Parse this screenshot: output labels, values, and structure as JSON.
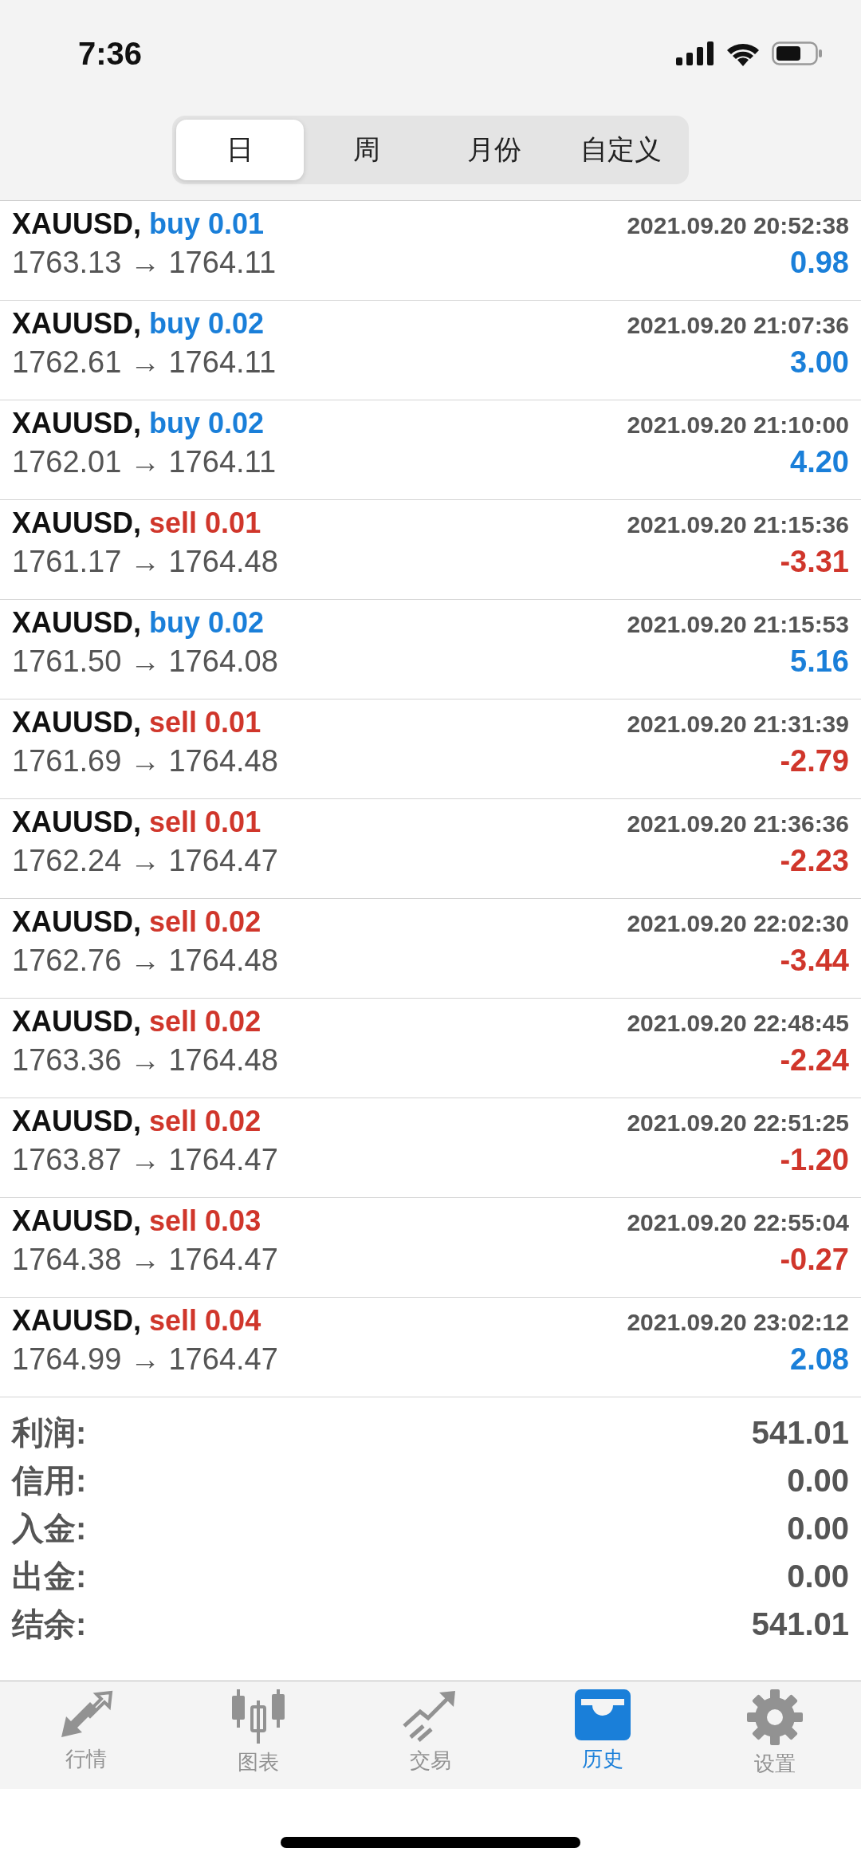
{
  "status_bar": {
    "time": "7:36"
  },
  "period_tabs": [
    {
      "label": "日",
      "selected": true
    },
    {
      "label": "周",
      "selected": false
    },
    {
      "label": "月份",
      "selected": false
    },
    {
      "label": "自定义",
      "selected": false
    }
  ],
  "deals": [
    {
      "symbol": "XAUUSD,",
      "kind": "buy",
      "order": "buy 0.01",
      "time": "2021.09.20 20:52:38",
      "prices": "1763.13 → 1764.11",
      "profit": "0.98",
      "profit_positive": true
    },
    {
      "symbol": "XAUUSD,",
      "kind": "buy",
      "order": "buy 0.02",
      "time": "2021.09.20 21:07:36",
      "prices": "1762.61 → 1764.11",
      "profit": "3.00",
      "profit_positive": true
    },
    {
      "symbol": "XAUUSD,",
      "kind": "buy",
      "order": "buy 0.02",
      "time": "2021.09.20 21:10:00",
      "prices": "1762.01 → 1764.11",
      "profit": "4.20",
      "profit_positive": true
    },
    {
      "symbol": "XAUUSD,",
      "kind": "sell",
      "order": "sell 0.01",
      "time": "2021.09.20 21:15:36",
      "prices": "1761.17 → 1764.48",
      "profit": "-3.31",
      "profit_positive": false
    },
    {
      "symbol": "XAUUSD,",
      "kind": "buy",
      "order": "buy 0.02",
      "time": "2021.09.20 21:15:53",
      "prices": "1761.50 → 1764.08",
      "profit": "5.16",
      "profit_positive": true
    },
    {
      "symbol": "XAUUSD,",
      "kind": "sell",
      "order": "sell 0.01",
      "time": "2021.09.20 21:31:39",
      "prices": "1761.69 → 1764.48",
      "profit": "-2.79",
      "profit_positive": false
    },
    {
      "symbol": "XAUUSD,",
      "kind": "sell",
      "order": "sell 0.01",
      "time": "2021.09.20 21:36:36",
      "prices": "1762.24 → 1764.47",
      "profit": "-2.23",
      "profit_positive": false
    },
    {
      "symbol": "XAUUSD,",
      "kind": "sell",
      "order": "sell 0.02",
      "time": "2021.09.20 22:02:30",
      "prices": "1762.76 → 1764.48",
      "profit": "-3.44",
      "profit_positive": false
    },
    {
      "symbol": "XAUUSD,",
      "kind": "sell",
      "order": "sell 0.02",
      "time": "2021.09.20 22:48:45",
      "prices": "1763.36 → 1764.48",
      "profit": "-2.24",
      "profit_positive": false
    },
    {
      "symbol": "XAUUSD,",
      "kind": "sell",
      "order": "sell 0.02",
      "time": "2021.09.20 22:51:25",
      "prices": "1763.87 → 1764.47",
      "profit": "-1.20",
      "profit_positive": false
    },
    {
      "symbol": "XAUUSD,",
      "kind": "sell",
      "order": "sell 0.03",
      "time": "2021.09.20 22:55:04",
      "prices": "1764.38 → 1764.47",
      "profit": "-0.27",
      "profit_positive": false
    },
    {
      "symbol": "XAUUSD,",
      "kind": "sell",
      "order": "sell 0.04",
      "time": "2021.09.20 23:02:12",
      "prices": "1764.99 → 1764.47",
      "profit": "2.08",
      "profit_positive": true
    }
  ],
  "summary": [
    {
      "label": "利润:",
      "value": "541.01"
    },
    {
      "label": "信用:",
      "value": "0.00"
    },
    {
      "label": "入金:",
      "value": "0.00"
    },
    {
      "label": "出金:",
      "value": "0.00"
    },
    {
      "label": "结余:",
      "value": "541.01"
    }
  ],
  "tab_bar": [
    {
      "kind": "quotes",
      "label": "行情",
      "selected": false
    },
    {
      "kind": "chart",
      "label": "图表",
      "selected": false
    },
    {
      "kind": "trade",
      "label": "交易",
      "selected": false
    },
    {
      "kind": "history",
      "label": "历史",
      "selected": true
    },
    {
      "kind": "settings",
      "label": "设置",
      "selected": false
    }
  ]
}
